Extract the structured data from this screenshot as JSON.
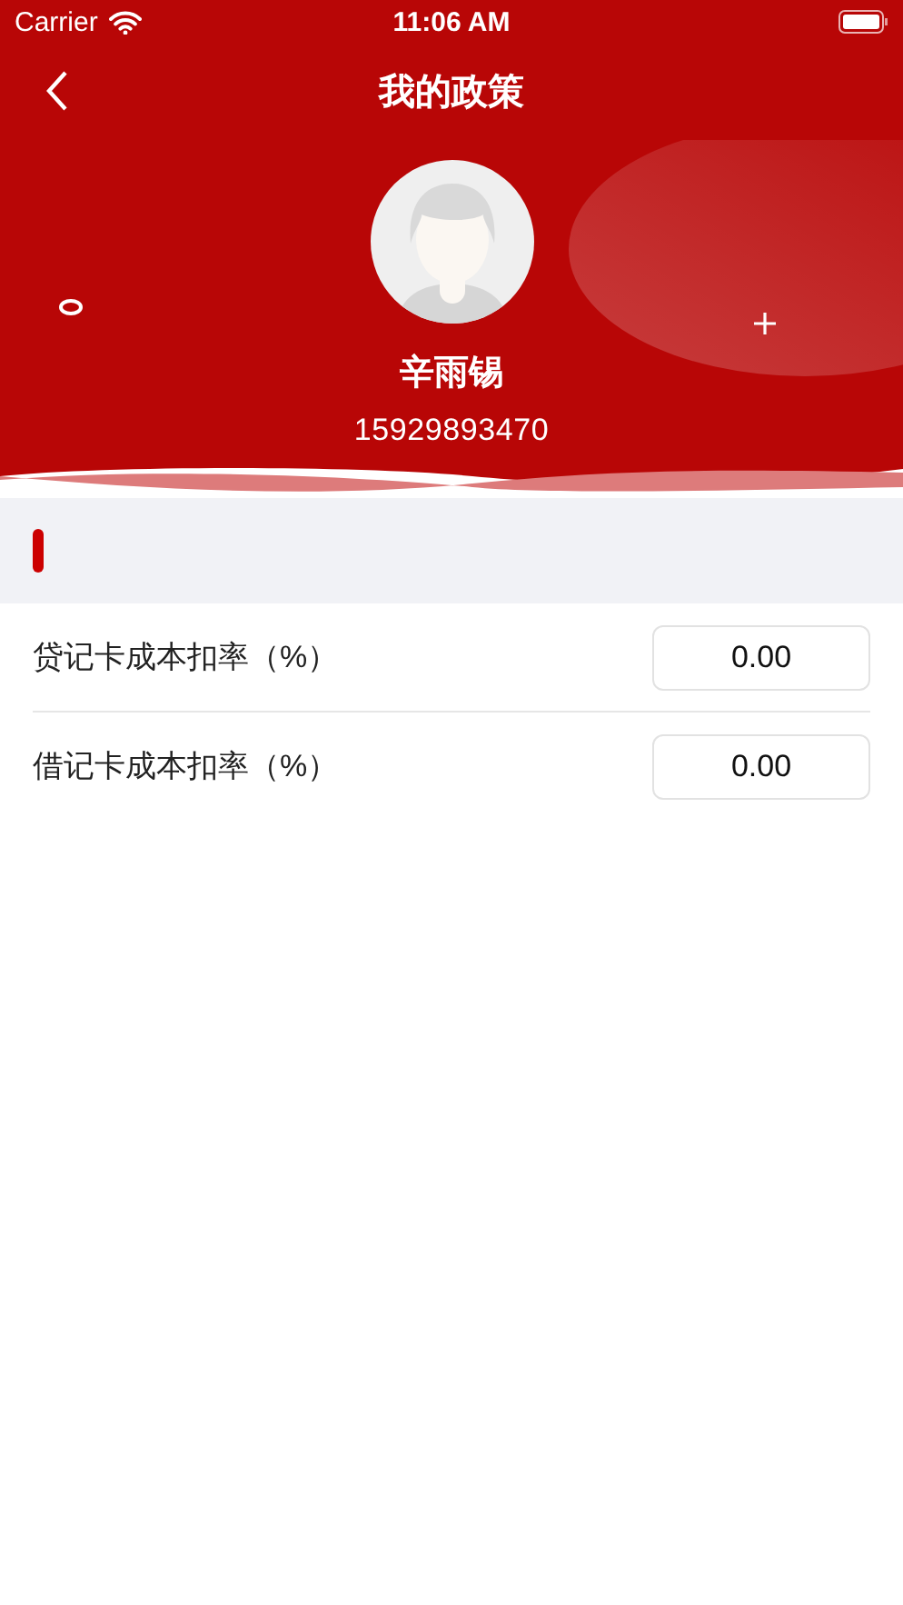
{
  "status_bar": {
    "carrier": "Carrier",
    "time": "11:06 AM"
  },
  "nav": {
    "title": "我的政策"
  },
  "profile": {
    "name": "辛雨锡",
    "phone": "15929893470"
  },
  "rates": [
    {
      "label": "贷记卡成本扣率（%）",
      "value": "0.00"
    },
    {
      "label": "借记卡成本扣率（%）",
      "value": "0.00"
    }
  ]
}
